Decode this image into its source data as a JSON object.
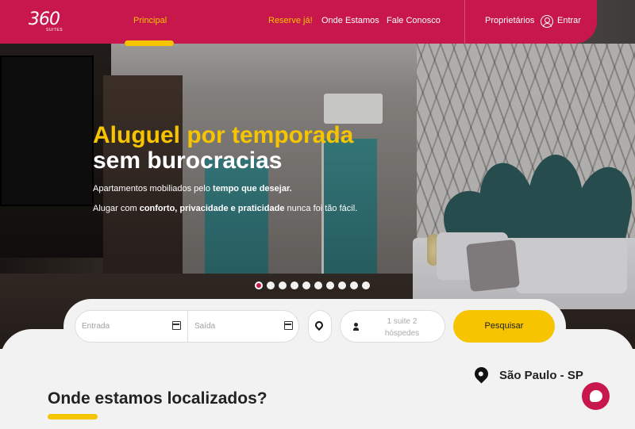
{
  "logo": {
    "text": "360",
    "sub": "SUITES"
  },
  "nav": {
    "principal": "Principal",
    "reserve": "Reserve já!",
    "onde_estamos": "Onde Estamos",
    "fale_conosco": "Fale Conosco",
    "proprietarios": "Proprietários",
    "entrar": "Entrar"
  },
  "hero": {
    "title_line1": "Aluguel por temporada",
    "title_line2": "sem burocracias",
    "p1_a": "Apartamentos mobiliados pelo ",
    "p1_b": "tempo que desejar.",
    "p2_a": "Alugar com ",
    "p2_b": "conforto, privacidade e praticidade",
    "p2_c": " nunca foi tão fácil.",
    "slide_count": 10,
    "active_slide": 1
  },
  "search": {
    "entrada_placeholder": "Entrada",
    "saida_placeholder": "Saída",
    "guests_line1": "1 suite 2",
    "guests_line2": "hóspedes",
    "button": "Pesquisar"
  },
  "location": {
    "city": "São Paulo - SP",
    "title_a": "Onde estamos ",
    "title_b": "localizados?"
  },
  "colors": {
    "primary": "#c8174d",
    "accent": "#f6c400",
    "background": "#f2f2f2"
  },
  "icons": [
    "user-icon",
    "calendar-icon",
    "map-pin-icon",
    "person-icon",
    "chat-icon"
  ]
}
